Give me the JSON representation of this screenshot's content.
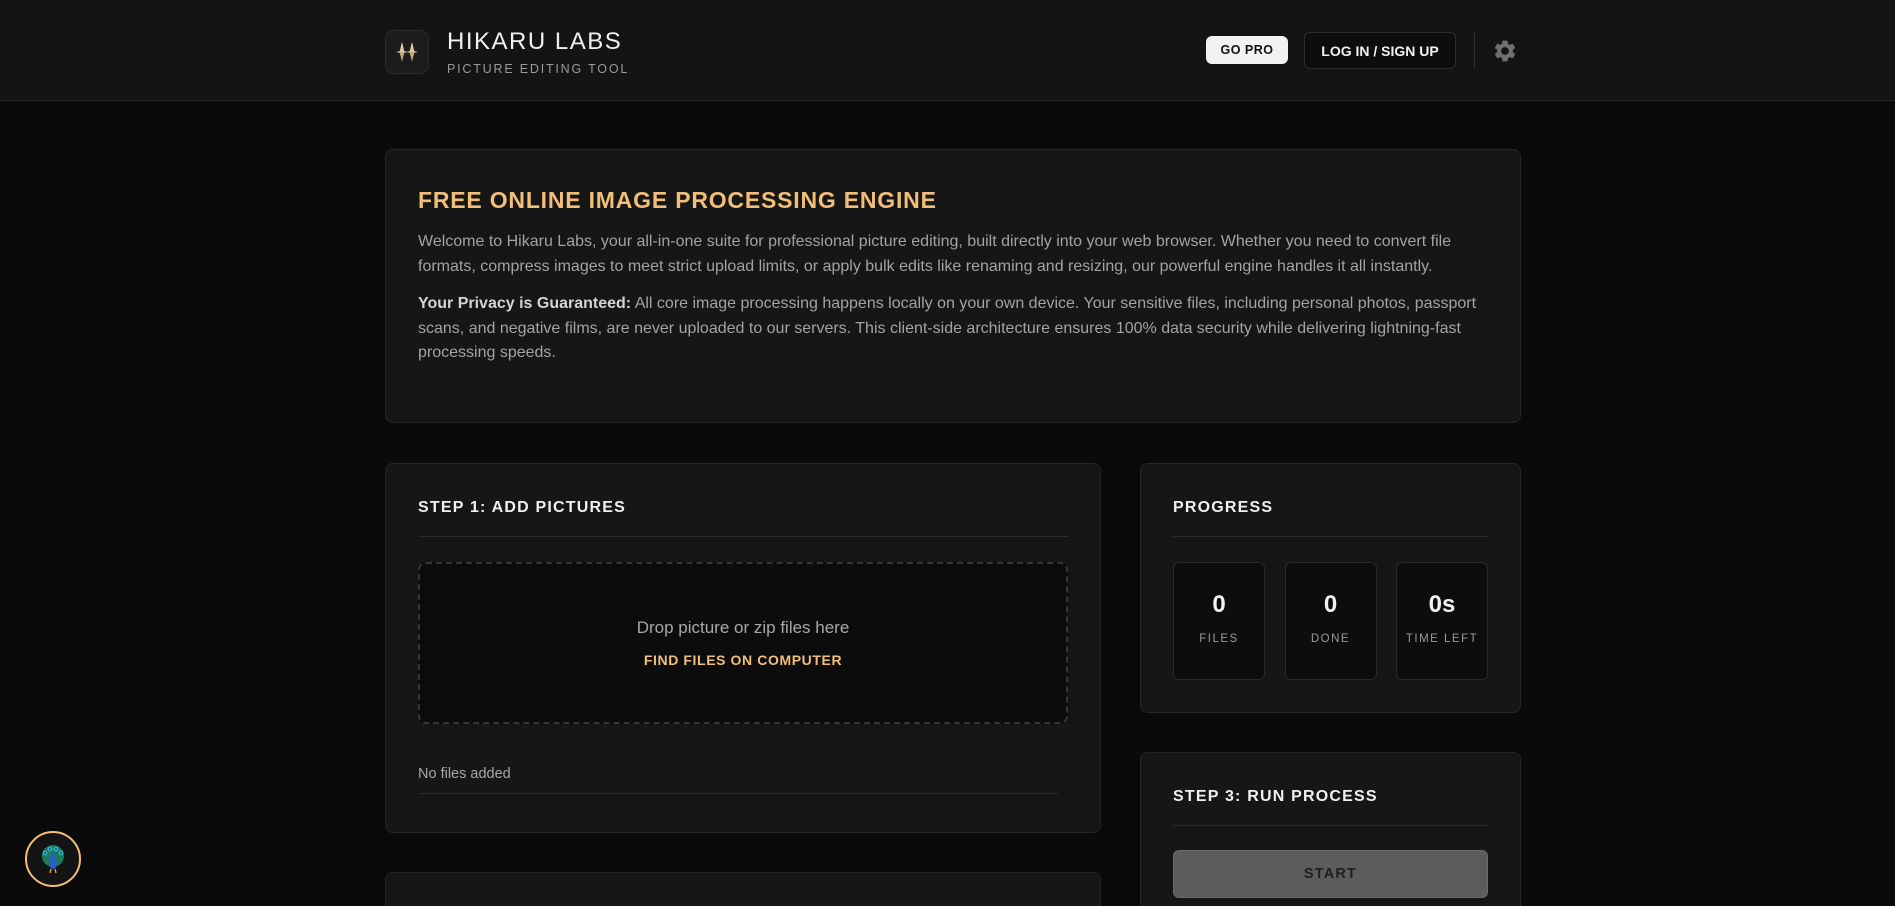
{
  "header": {
    "title": "HIKARU LABS",
    "subtitle": "PICTURE EDITING TOOL",
    "go_pro_label": "GO PRO",
    "login_label": "LOG IN / SIGN UP",
    "logo_icon": "sparkle-diamonds-icon",
    "settings_icon": "gear-icon"
  },
  "intro": {
    "heading": "FREE ONLINE IMAGE PROCESSING ENGINE",
    "paragraph": "Welcome to Hikaru Labs, your all-in-one suite for professional picture editing, built directly into your web browser. Whether you need to convert file formats, compress images to meet strict upload limits, or apply bulk edits like renaming and resizing, our powerful engine handles it all instantly.",
    "privacy_label": "Your Privacy is Guaranteed:",
    "privacy_text": " All core image processing happens locally on your own device. Your sensitive files, including personal photos, passport scans, and negative films, are never uploaded to our servers. This client-side architecture ensures 100% data security while delivering lightning-fast processing speeds."
  },
  "step1": {
    "title": "STEP 1: ADD PICTURES",
    "drop_text": "Drop picture or zip files here",
    "find_label": "FIND FILES ON COMPUTER",
    "empty_text": "No files added"
  },
  "progress": {
    "title": "PROGRESS",
    "stats": [
      {
        "value": "0",
        "label": "FILES"
      },
      {
        "value": "0",
        "label": "DONE"
      },
      {
        "value": "0s",
        "label": "TIME LEFT"
      }
    ]
  },
  "step3": {
    "title": "STEP 3: RUN PROCESS",
    "start_label": "START"
  },
  "floating": {
    "avatar_icon": "peacock-icon"
  },
  "colors": {
    "accent": "#f3bf77",
    "background": "#0a0a0a",
    "card": "#161616"
  }
}
